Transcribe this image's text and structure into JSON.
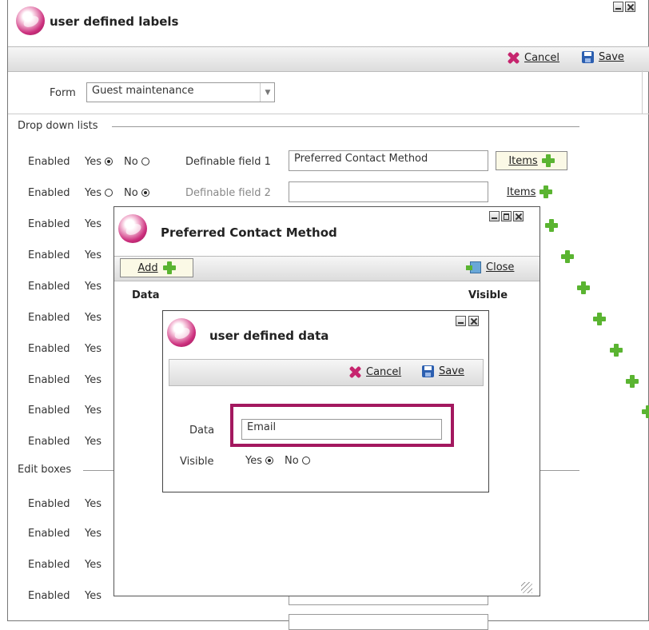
{
  "main": {
    "title": "user defined labels",
    "toolbar": {
      "cancel": "Cancel",
      "save": "Save"
    },
    "form_label": "Form",
    "form_value": "Guest maintenance",
    "dropdown_section": "Drop down lists",
    "edit_section": "Edit boxes",
    "enabled_label": "Enabled",
    "yes_label": "Yes",
    "no_label": "No",
    "field1_label": "Definable field 1",
    "field1_value": "Preferred Contact Method",
    "field2_label": "Definable field 2",
    "field2_value": "",
    "items_label": "Items"
  },
  "popup1": {
    "title": "Preferred Contact Method",
    "add_label": "Add",
    "close_label": "Close",
    "col_data": "Data",
    "col_visible": "Visible"
  },
  "popup2": {
    "title": "user defined data",
    "cancel": "Cancel",
    "save": "Save",
    "data_label": "Data",
    "data_value": "Email",
    "visible_label": "Visible",
    "yes_label": "Yes",
    "no_label": "No"
  },
  "colors": {
    "highlight": "#a3185f",
    "plus": "#5ab431"
  }
}
